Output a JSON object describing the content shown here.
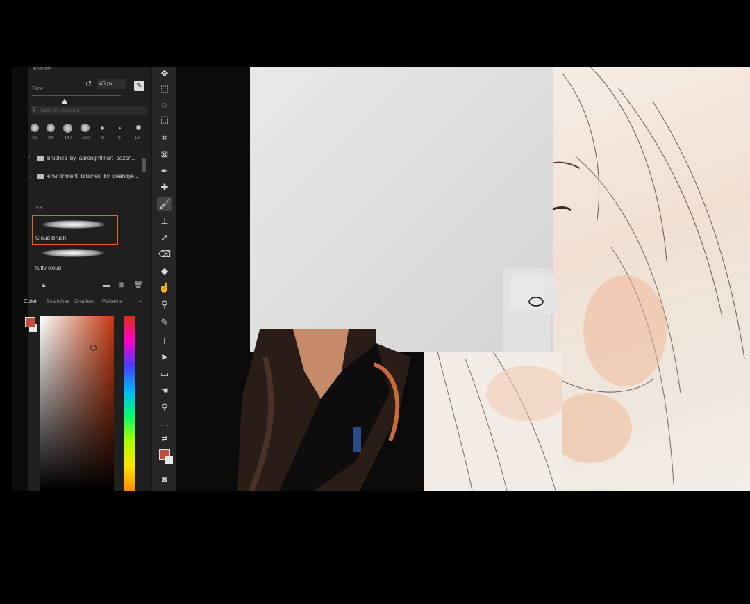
{
  "panel": {
    "title": "Brushes",
    "size_label": "Size:",
    "size_value": "45 px",
    "search_placeholder": "Search Brushes"
  },
  "presets": [
    {
      "size": "45"
    },
    {
      "size": "84"
    },
    {
      "size": "147"
    },
    {
      "size": "100"
    },
    {
      "size": "9"
    },
    {
      "size": "6"
    },
    {
      "size": "12"
    }
  ],
  "folders": [
    {
      "label": "brushes_by_aarongriffinart_da2sn..."
    },
    {
      "label": "environment_brushes_by_deanoye..."
    }
  ],
  "brush_group": "t-3",
  "brushes": [
    {
      "label": "Cloud Brush",
      "selected": true
    },
    {
      "label": "fluffy cloud",
      "selected": false
    }
  ],
  "color_panel": {
    "tabs": [
      "Color",
      "Swatches",
      "Gradient",
      "Patterns"
    ],
    "active_tab": "Color",
    "foreground": "#c24e3a",
    "background": "#e8e8e8"
  },
  "toolbar": {
    "tools": [
      "move-icon",
      "marquee-icon",
      "lasso-icon",
      "object-select-icon",
      "crop-icon",
      "frame-icon",
      "eyedropper-icon",
      "healing-icon",
      "brush-icon",
      "clone-stamp-icon",
      "history-brush-icon",
      "eraser-icon",
      "paint-bucket-icon",
      "smudge-icon",
      "dodge-icon",
      "pen-icon",
      "type-icon",
      "path-select-icon",
      "rectangle-icon",
      "hand-icon",
      "zoom-icon",
      "more-icon"
    ],
    "active_tool": "brush-icon",
    "type_glyph": "T"
  }
}
